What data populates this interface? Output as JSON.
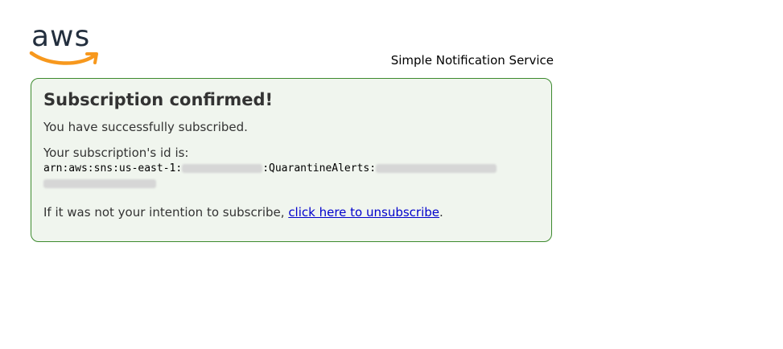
{
  "logo": {
    "text": "aws",
    "smile_color": "#f7981d",
    "text_color": "#232f3e"
  },
  "header": {
    "service_name": "Simple Notification Service"
  },
  "panel": {
    "title": "Subscription confirmed!",
    "success_message": "You have successfully subscribed.",
    "id_label": "Your subscription's id is:",
    "arn_prefix": "arn:aws:sns:us-east-1:",
    "arn_topic": ":QuarantineAlerts:",
    "unsubscribe_prefix": "If it was not your intention to subscribe, ",
    "unsubscribe_link": "click here to unsubscribe",
    "unsubscribe_suffix": ".",
    "border_color": "#3c8a2e",
    "background_color": "#f0f5ee"
  }
}
